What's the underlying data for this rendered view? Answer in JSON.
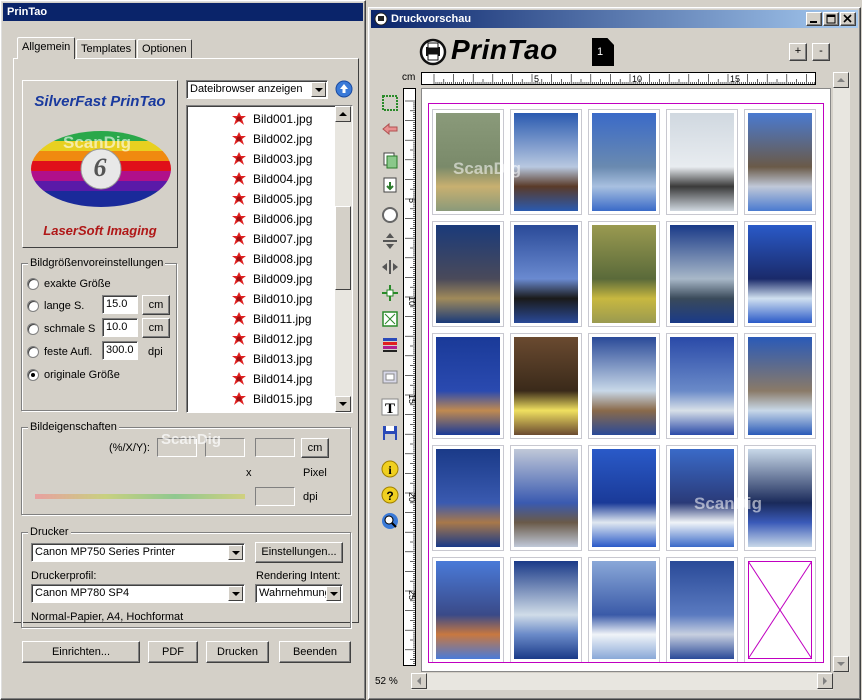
{
  "left_window": {
    "title": "PrinTao",
    "tabs": [
      {
        "label": "Allgemein",
        "active": true
      },
      {
        "label": "Templates",
        "active": false
      },
      {
        "label": "Optionen",
        "active": false
      }
    ],
    "logo": {
      "top_text": "SilverFast PrinTao",
      "bottom_text": "LaserSoft Imaging",
      "number": "6",
      "watermark": "ScanDig"
    },
    "file_browser": {
      "mode_select": "Dateibrowser anzeigen",
      "files": [
        "Bild001.jpg",
        "Bild002.jpg",
        "Bild003.jpg",
        "Bild004.jpg",
        "Bild005.jpg",
        "Bild006.jpg",
        "Bild007.jpg",
        "Bild008.jpg",
        "Bild009.jpg",
        "Bild010.jpg",
        "Bild011.jpg",
        "Bild012.jpg",
        "Bild013.jpg",
        "Bild014.jpg",
        "Bild015.jpg"
      ]
    },
    "size_presets": {
      "label": "Bildgrößenvoreinstellungen",
      "options": [
        {
          "label": "exakte Größe",
          "selected": false
        },
        {
          "label": "lange S.",
          "selected": false,
          "value": "15.0",
          "unit": "cm"
        },
        {
          "label": "schmale S",
          "selected": false,
          "value": "10.0",
          "unit": "cm"
        },
        {
          "label": "feste Aufl.",
          "selected": false,
          "value": "300.0",
          "unit": "dpi"
        },
        {
          "label": "originale Größe",
          "selected": true
        }
      ]
    },
    "image_props": {
      "label": "Bildeigenschaften",
      "coord_label": "(%/X/Y):",
      "unit": "cm",
      "x": "x",
      "pixel": "Pixel",
      "dpi": "dpi",
      "watermark": "ScanDig"
    },
    "printer": {
      "label": "Drucker",
      "printer_select": "Canon MP750 Series Printer",
      "settings_button": "Einstellungen...",
      "profile_label": "Druckerprofil:",
      "profile_select": "Canon MP780 SP4",
      "intent_label": "Rendering Intent:",
      "intent_select": "Wahrnehmung",
      "paper_info": "Normal-Papier, A4, Hochformat"
    },
    "buttons": {
      "setup": "Einrichten...",
      "pdf": "PDF",
      "print": "Drucken",
      "quit": "Beenden"
    }
  },
  "right_window": {
    "title": "Druckvorschau",
    "brand": "PrinTao",
    "page_number": "1",
    "zoom_in": "+",
    "zoom_out": "-",
    "ruler_unit": "cm",
    "ruler_h_labels": [
      "5",
      "10",
      "15",
      "20"
    ],
    "ruler_v_labels": [
      "5",
      "10",
      "15",
      "20",
      "25"
    ],
    "zoom_level": "52 %",
    "watermark": "ScanDig",
    "tools": [
      "select-icon",
      "back-arrow-icon",
      "copy-icon",
      "paste-icon",
      "circle-icon",
      "vertical-fit-icon",
      "horizontal-fit-icon",
      "center-icon",
      "fit-page-icon",
      "color-bars-icon",
      "frame-icon",
      "text-icon",
      "save-icon",
      "info-icon",
      "help-icon",
      "zoom-icon"
    ],
    "colors": {
      "crop_mark": "#c000c0",
      "sky_blue": "#1f4fa8",
      "paper": "#ffffff"
    }
  }
}
